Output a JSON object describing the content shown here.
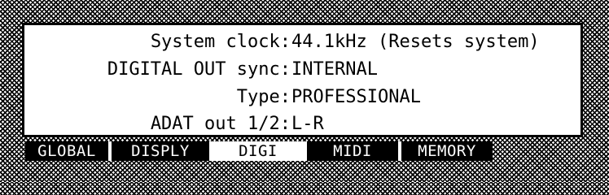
{
  "screen": {
    "settings": [
      {
        "label": "System clock:",
        "value": "44.1kHz (Resets system)"
      },
      {
        "label": "DIGITAL OUT sync:",
        "value": "INTERNAL"
      },
      {
        "label": "Type:",
        "value": "PROFESSIONAL"
      },
      {
        "label": "ADAT out 1/2:",
        "value": "L-R"
      }
    ]
  },
  "tabs": [
    {
      "label": "GLOBAL",
      "selected": false
    },
    {
      "label": "DISPLY",
      "selected": false
    },
    {
      "label": "DIGI",
      "selected": true
    },
    {
      "label": "MIDI",
      "selected": false
    },
    {
      "label": "MEMORY",
      "selected": false
    }
  ],
  "colors": {
    "lcd_background": "#ffffff",
    "lcd_ink": "#000000"
  }
}
